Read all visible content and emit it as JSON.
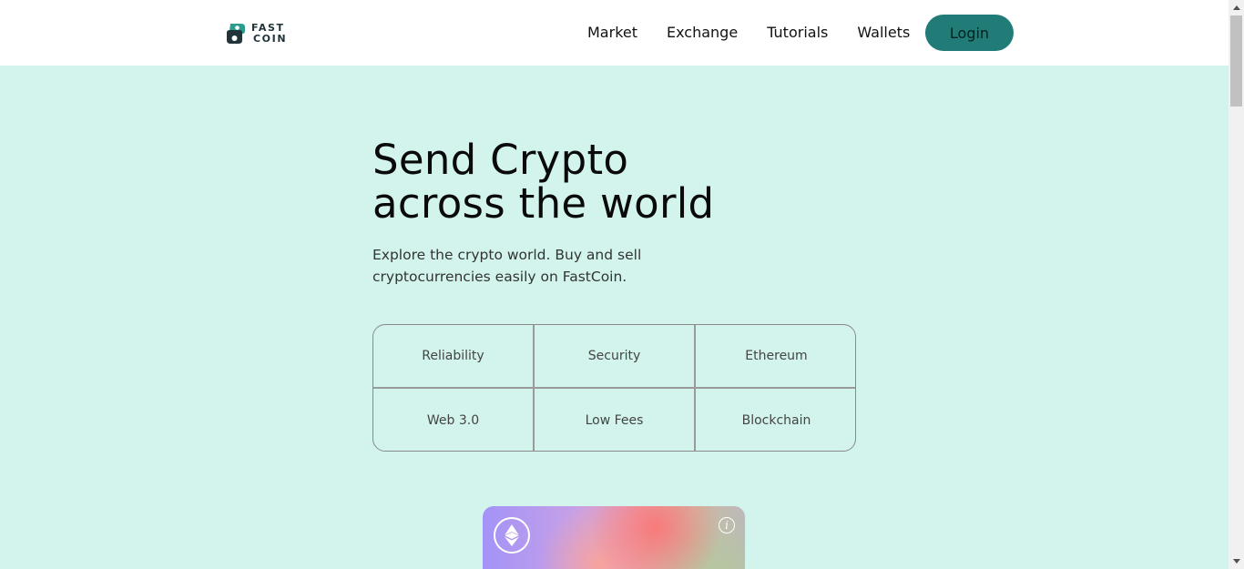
{
  "brand": {
    "line1": "FAST",
    "line2": "COIN"
  },
  "nav": {
    "links": [
      "Market",
      "Exchange",
      "Tutorials",
      "Wallets"
    ],
    "login_label": "Login"
  },
  "hero": {
    "title_line1": "Send Crypto",
    "title_line2": "across the world",
    "subtitle": "Explore the crypto world. Buy and sell cryptocurrencies easily on FastCoin."
  },
  "features": [
    "Reliability",
    "Security",
    "Ethereum",
    "Web 3.0",
    "Low Fees",
    "Blockchain"
  ],
  "card": {
    "icon": "ethereum-icon",
    "info_glyph": "i"
  },
  "colors": {
    "page_bg": "#d2f4ec",
    "nav_bg": "#ffffff",
    "accent": "#217b76",
    "brand_dark": "#20343a"
  }
}
